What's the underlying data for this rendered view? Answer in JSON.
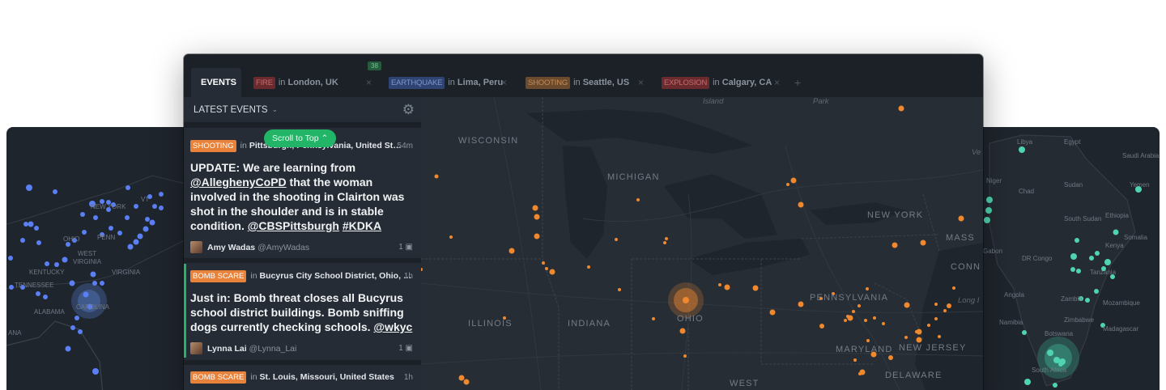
{
  "tabs": {
    "events_label": "EVENTS",
    "items": [
      {
        "tag": "FIRE",
        "in": "in",
        "place": "London, UK"
      },
      {
        "tag": "EARTHQUAKE",
        "in": "in",
        "place": "Lima, Peru"
      },
      {
        "tag": "SHOOTING",
        "in": "in",
        "place": "Seattle, US"
      },
      {
        "tag": "EXPLOSION",
        "in": "in",
        "place": "Calgary, CA"
      }
    ],
    "new_count": "38",
    "close_glyph": "×",
    "add_glyph": "+"
  },
  "sidebar": {
    "title": "LATEST EVENTS",
    "scroll_to_top": "Scroll to Top",
    "cards": [
      {
        "tag": "SHOOTING",
        "in": "in",
        "location": "Pittsburgh, Pennsylvania, United States",
        "time": "54m",
        "body_text": "UPDATE: We are learning from ",
        "body_link1": "@AlleghenyCoPD",
        "body_text2": " that the woman involved in the shooting in Clairton was shot in the shoulder and is in stable condition. ",
        "body_link2": "@CBSPittsburgh",
        "body_link3": "#KDKA",
        "author_name": "Amy Wadas",
        "author_handle": "@AmyWadas",
        "media_count": "1"
      },
      {
        "tag": "BOMB SCARE",
        "in": "in",
        "location": "Bucyrus City School District, Ohio, Uni...",
        "time": "1h",
        "body_text": "Just in: Bomb threat closes all Bucyrus school district buildings. Bomb sniffing dogs currently checking schools. ",
        "body_link1": "@wkyc",
        "author_name": "Lynna Lai",
        "author_handle": "@Lynna_Lai",
        "media_count": "1"
      },
      {
        "tag": "BOMB SCARE",
        "in": "in",
        "location": "St. Louis, Missouri, United States",
        "time": "1h"
      }
    ]
  },
  "map": {
    "labels": {
      "wisconsin": "WISCONSIN",
      "michigan": "MICHIGAN",
      "new_york": "NEW YORK",
      "mass": "MASS",
      "conn": "CONN",
      "pennsylvania": "PENNSYLVANIA",
      "ohio": "OHIO",
      "illinois": "ILLINOIS",
      "indiana": "INDIANA",
      "maryland": "MARYLAND",
      "new_jersey": "NEW JERSEY",
      "delaware": "DELAWARE",
      "west": "WEST",
      "island": "Island",
      "park": "Park",
      "long": "Long I",
      "ve": "Ve"
    }
  },
  "left_panel": {
    "labels": [
      "VT",
      "NEW YORK",
      "OHIO",
      "PENN",
      "WEST",
      "VIRGINIA",
      "VIRGINIA",
      "KENTUCKY",
      "TENNESSEE",
      "CAROLINA",
      "ALABAMA",
      "ANA"
    ]
  },
  "right_panel": {
    "labels": [
      "Libya",
      "Egypt",
      "Saudi Arabia",
      "Niger",
      "Chad",
      "Sudan",
      "Yemen",
      "South Sudan",
      "Ethiopia",
      "Somalia",
      "Kenya",
      "Gabon",
      "DR Congo",
      "Tanzania",
      "Angola",
      "Zambia",
      "Mozambique",
      "Zimbabwe",
      "Namibia",
      "Botswana",
      "Madagascar",
      "South Africa"
    ]
  },
  "colors": {
    "accent_green": "#22b467",
    "event_orange": "#f0882e",
    "cluster_blue": "#5b7ff5",
    "cluster_teal": "#4fd4b0"
  }
}
